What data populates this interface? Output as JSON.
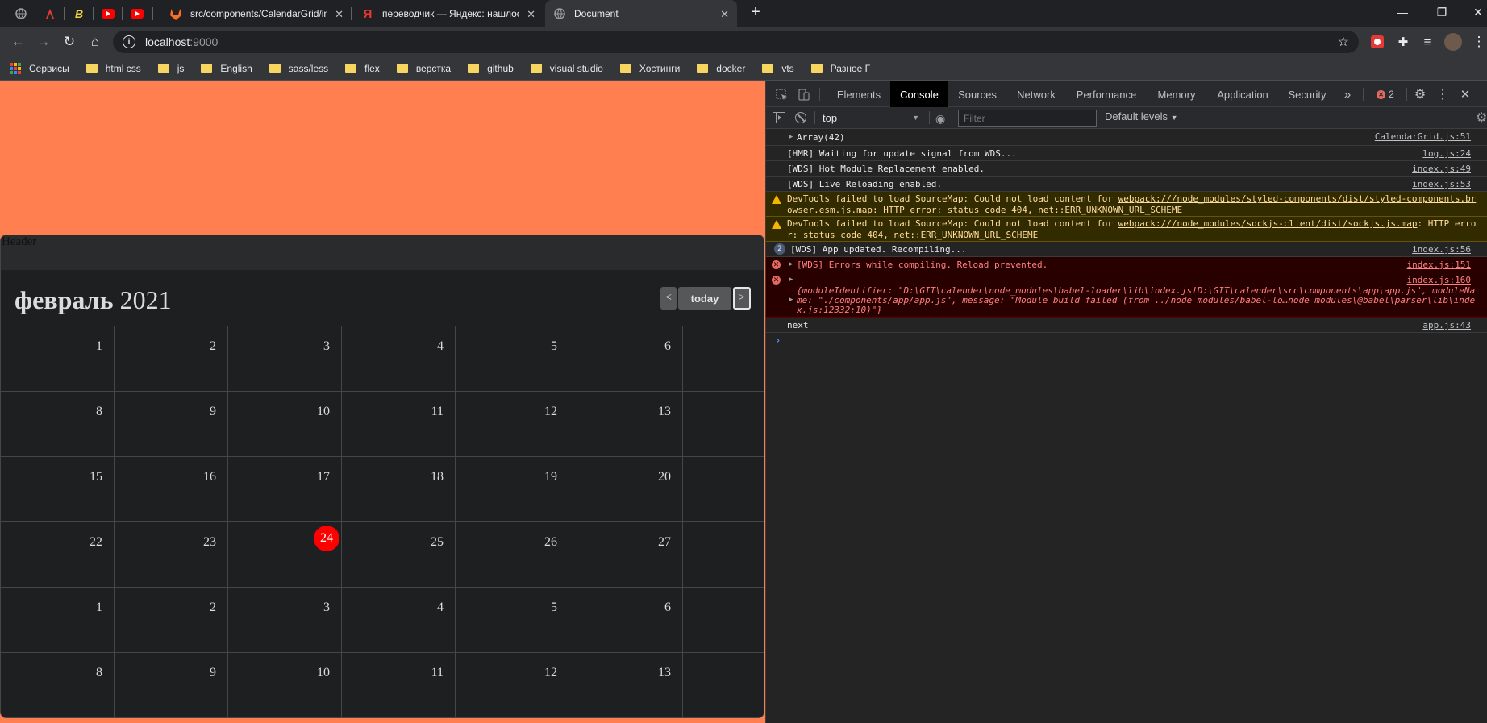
{
  "tabs": [
    {
      "title": "",
      "icon": "globe-icon"
    },
    {
      "title": "",
      "icon": "red-logo-icon"
    },
    {
      "title": "",
      "icon": "yellow-b-icon"
    },
    {
      "title": "",
      "icon": "youtube-icon"
    },
    {
      "title": "",
      "icon": "youtube-icon"
    },
    {
      "title": "src/components/CalendarGrid/in",
      "icon": "gitlab-icon"
    },
    {
      "title": "переводчик — Яндекс: нашлос",
      "icon": "yandex-icon"
    },
    {
      "title": "Document",
      "icon": "globe-icon"
    }
  ],
  "address": {
    "host": "localhost",
    "port": ":9000"
  },
  "bookmarks": [
    "Сервисы",
    "html css",
    "js",
    "English",
    "sass/less",
    "flex",
    "верстка",
    "github",
    "visual studio",
    "Хостинги",
    "docker",
    "vts",
    "Разное Г"
  ],
  "colors": {
    "page_bg": "#ff7f50",
    "today": "#ff0000",
    "folder": "#f6d560"
  },
  "calendar": {
    "header_label": "Header",
    "month": "февраль",
    "year": "2021",
    "prev_label": "<",
    "today_label": "today",
    "next_label": ">",
    "today_value": "24",
    "weeks": [
      [
        "1",
        "2",
        "3",
        "4",
        "5",
        "6",
        ""
      ],
      [
        "8",
        "9",
        "10",
        "11",
        "12",
        "13",
        ""
      ],
      [
        "15",
        "16",
        "17",
        "18",
        "19",
        "20",
        ""
      ],
      [
        "22",
        "23",
        "24",
        "25",
        "26",
        "27",
        ""
      ],
      [
        "1",
        "2",
        "3",
        "4",
        "5",
        "6",
        ""
      ],
      [
        "8",
        "9",
        "10",
        "11",
        "12",
        "13",
        ""
      ]
    ]
  },
  "devtools": {
    "tabs": [
      "Elements",
      "Console",
      "Sources",
      "Network",
      "Performance",
      "Memory",
      "Application",
      "Security"
    ],
    "active_tab": "Console",
    "more": "»",
    "error_count": "2",
    "context": "top",
    "filter_placeholder": "Filter",
    "levels": "Default levels",
    "messages": [
      {
        "type": "log",
        "text": "Array(42)",
        "source": "CalendarGrid.js:51"
      },
      {
        "type": "log",
        "text": "[HMR] Waiting for update signal from WDS...",
        "source": "log.js:24"
      },
      {
        "type": "log",
        "text": "[WDS] Hot Module Replacement enabled.",
        "source": "index.js:49"
      },
      {
        "type": "log",
        "text": "[WDS] Live Reloading enabled.",
        "source": "index.js:53"
      },
      {
        "type": "warn",
        "prefix": "DevTools failed to load SourceMap: Could not load content for ",
        "link": "webpack:///node_modules/styled-components/dist/styled-components.browser.esm.js.map",
        "suffix": ": HTTP error: status code 404, net::ERR_UNKNOWN_URL_SCHEME"
      },
      {
        "type": "warn",
        "prefix": "DevTools failed to load SourceMap: Could not load content for ",
        "link": "webpack:///node_modules/sockjs-client/dist/sockjs.js.map",
        "suffix": ": HTTP error: status code 404, net::ERR_UNKNOWN_URL_SCHEME"
      },
      {
        "type": "log",
        "count": "2",
        "text": "[WDS] App updated. Recompiling...",
        "source": "index.js:56"
      },
      {
        "type": "error",
        "text": "[WDS] Errors while compiling. Reload prevented.",
        "source": "index.js:151"
      },
      {
        "type": "error",
        "source": "index.js:160",
        "text": "{moduleIdentifier: \"D:\\GIT\\calender\\node_modules\\babel-loader\\lib\\index.js!D:\\GIT\\calender\\src\\components\\app\\app.js\", moduleName: \"./components/app/app.js\", message: \"Module build failed (from ../node_modules/babel-lo…node_modules\\@babel\\parser\\lib\\index.js:12332:10)\"}"
      },
      {
        "type": "log",
        "text": "next",
        "source": "app.js:43"
      }
    ],
    "prompt": "›"
  }
}
